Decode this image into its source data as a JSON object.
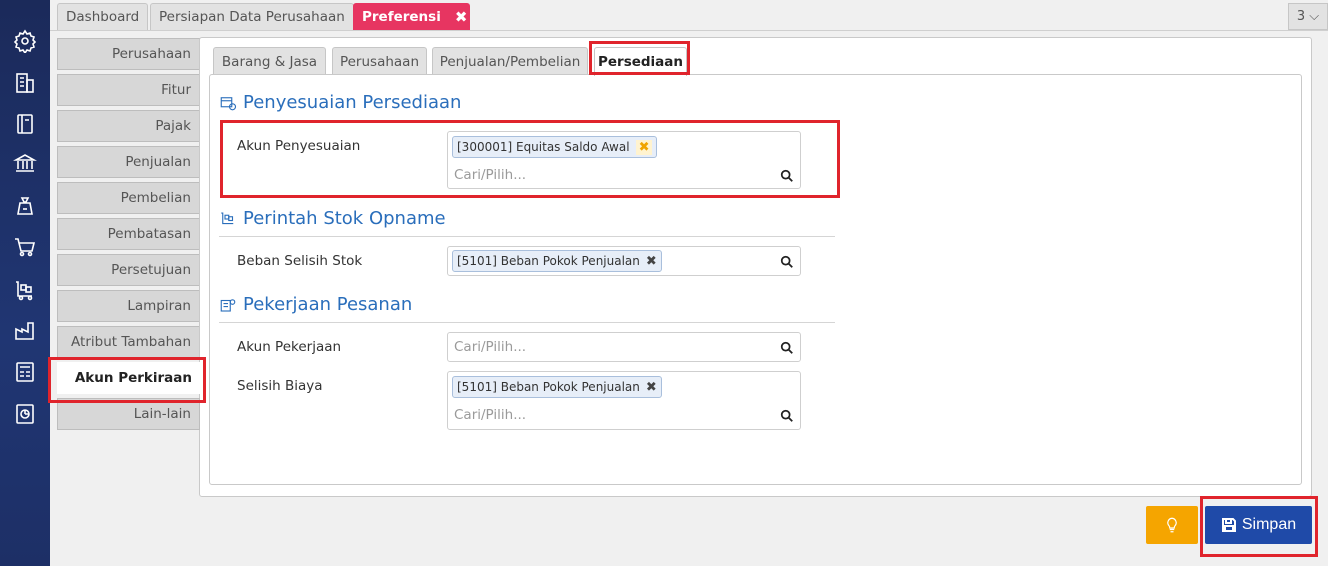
{
  "top_tabs": [
    {
      "label": "Dashboard"
    },
    {
      "label": "Persiapan Data Perusahaan"
    },
    {
      "label": "Preferensi",
      "close": "✖"
    }
  ],
  "tab_counter": "3 ⌵",
  "sidebar_icons": [
    "gear-icon",
    "building-icon",
    "book-icon",
    "bank-icon",
    "money-bag-icon",
    "cart-icon",
    "inventory-cart-icon",
    "factory-icon",
    "tax-icon",
    "chart-icon"
  ],
  "subnav": [
    "Perusahaan",
    "Fitur",
    "Pajak",
    "Penjualan",
    "Pembelian",
    "Pembatasan",
    "Persetujuan",
    "Lampiran",
    "Atribut Tambahan",
    "Akun Perkiraan",
    "Lain-lain"
  ],
  "subnav_active": "Akun Perkiraan",
  "inner_tabs": [
    "Barang & Jasa",
    "Perusahaan",
    "Penjualan/Pembelian",
    "Persediaan"
  ],
  "inner_tab_active": "Persediaan",
  "sections": {
    "penyesuaian": {
      "title": "Penyesuaian Persediaan",
      "akun_label": "Akun Penyesuaian",
      "akun_chip": "[300001] Equitas Saldo Awal",
      "akun_placeholder": "Cari/Pilih..."
    },
    "opname": {
      "title": "Perintah Stok Opname",
      "beban_label": "Beban Selisih Stok",
      "beban_chip": "[5101] Beban Pokok Penjualan"
    },
    "pesanan": {
      "title": "Pekerjaan Pesanan",
      "akun_label": "Akun Pekerjaan",
      "akun_placeholder": "Cari/Pilih...",
      "selisih_label": "Selisih Biaya",
      "selisih_chip": "[5101] Beban Pokok Penjualan",
      "selisih_placeholder": "Cari/Pilih..."
    }
  },
  "chip_remove": "✖",
  "buttons": {
    "save": "Simpan"
  },
  "colors": {
    "accent": "#e73561",
    "primary": "#1f4aa8",
    "warning": "#f5a500",
    "highlight": "#e0242c",
    "section": "#2a6ebb"
  }
}
